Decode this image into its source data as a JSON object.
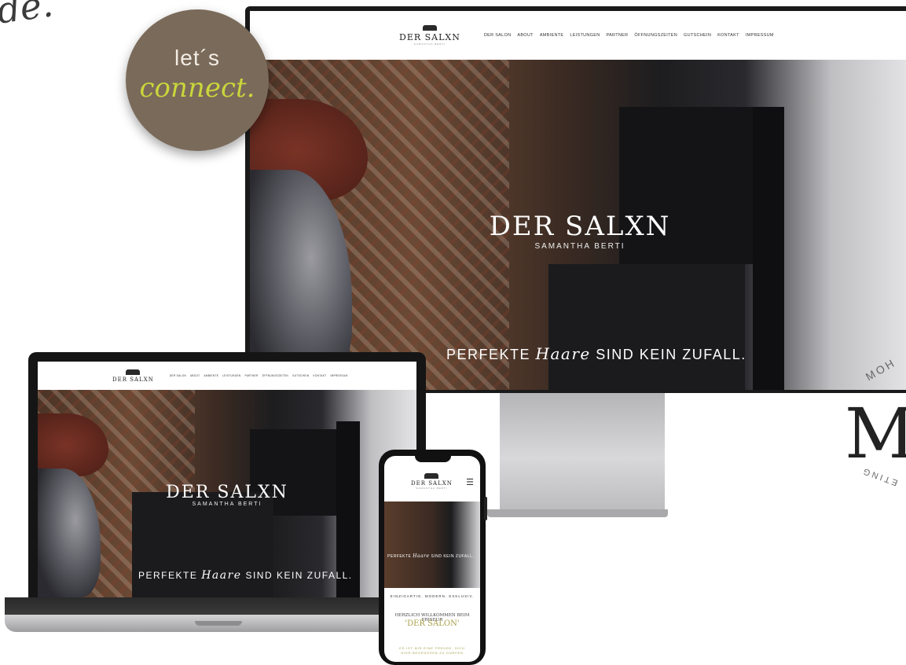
{
  "corner_script": "de.",
  "badge": {
    "line1": "let´s",
    "line2": "connect."
  },
  "site": {
    "logo": "DER SALXN",
    "logo_sub": "SAMANTHA BERTI",
    "nav": [
      "DER SALON",
      "ABOUT",
      "AMBIENTE",
      "LEISTUNGEN",
      "PARTNER",
      "ÖFFNUNGSZEITEN",
      "GUTSCHEIN",
      "KONTAKT",
      "IMPRESSUM"
    ],
    "hero_title": "DER SALXN",
    "hero_subtitle": "SAMANTHA BERTI",
    "tag_pre": "PERFEKTE",
    "tag_script": "Haare",
    "tag_post": "SIND KEIN ZUFALL."
  },
  "phone": {
    "menu_icon": "☰",
    "tagline": "EINZIGARTIG. MODERN. EXKLUSIV.",
    "welcome": "HERZLICH WILLKOMMEN BEIM FRISEUR",
    "salon": "'DER SALON'",
    "intro_line1": "ES IST MIR EINE FREUDE, DICH",
    "intro_line2": "HIER BEGRÜSSEN ZU DÜRFEN"
  },
  "right": {
    "big_letter": "M",
    "arc_top": "MOH",
    "arc_bottom": "ETING"
  },
  "colors": {
    "badge": "#7a6a5a",
    "accent": "#c9d63c",
    "gold": "#a8a04a"
  }
}
